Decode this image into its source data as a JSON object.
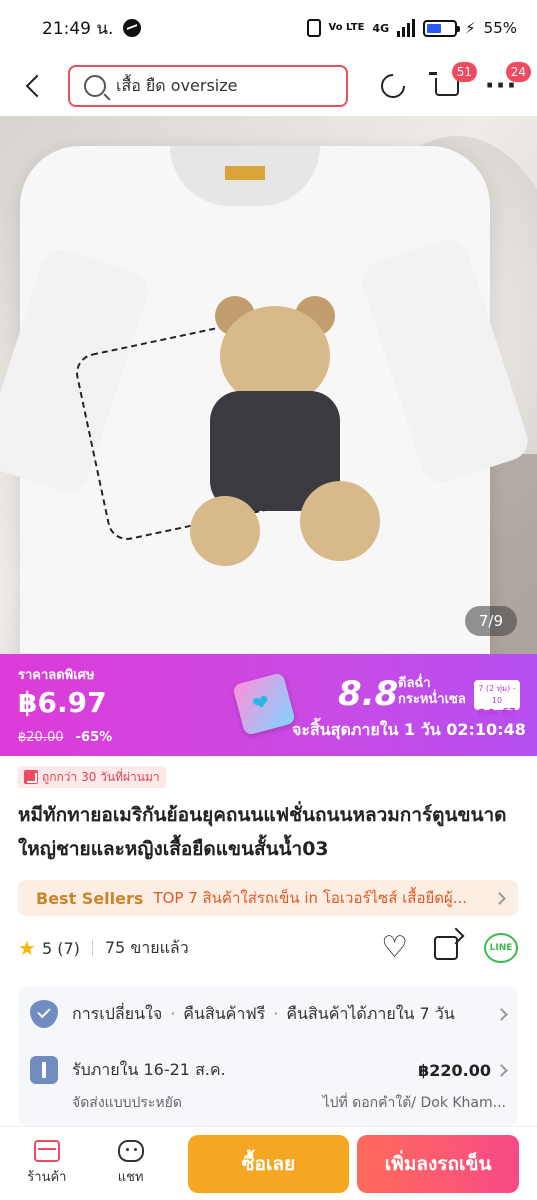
{
  "status_bar": {
    "time": "21:49 น.",
    "battery": "55%",
    "battery_level": 0.55,
    "network": "4G",
    "volte": "Vo LTE"
  },
  "nav": {
    "search_text": "เสื้อ ยืด oversize",
    "cart_badge": "51",
    "more_badge": "24"
  },
  "product_image": {
    "counter": "7/9"
  },
  "promo": {
    "label": "ราคาลดพิเศษ",
    "price": "฿6.97",
    "original_price": "฿20.00",
    "discount": "-65%",
    "event_big": "8.8",
    "event_line1": "ดีลฉ่ำ",
    "event_line2": "กระหน่ำเซล",
    "event_date_top": "7 (2 ทุ่ม) - 10",
    "event_date_bottom": "ส.ค. 67",
    "countdown": "จะสิ้นสุดภายใน 1 วัน 02:10:48"
  },
  "low_price_tag": "ถูกกว่า 30 วันที่ผ่านมา",
  "product": {
    "title": "หมีทักทายอเมริกันย้อนยุคถนนแฟชั่นถนนหลวมการ์ตูนขนาดใหญ่ชายและหญิงเสื้อยืดแขนสั้นน้ำ03"
  },
  "best_sellers": {
    "logo": "Best Sellers",
    "text": "TOP 7 สินค้าใส่รถเข็น in โอเวอร์ไซส์ เสื้อยืดผู้..."
  },
  "rating": {
    "score": "5 (7)",
    "sold": "75 ขายแล้ว"
  },
  "info": {
    "policy_1": "การเปลี่ยนใจ",
    "policy_2": "คืนสินค้าฟรี",
    "policy_3": "คืนสินค้าได้ภายใน 7 วัน",
    "delivery": "รับภายใน 16-21 ส.ค.",
    "shipping_price": "฿220.00",
    "shipping_type": "จัดส่งแบบประหยัด",
    "destination": "ไปที่ ดอกคำใต้/ Dok Kham..."
  },
  "bottom_bar": {
    "store_label": "ร้านค้า",
    "chat_label": "แชท",
    "buy_label": "ซื้อเลย",
    "add_cart_label": "เพิ่มลงรถเข็น"
  },
  "colors": {
    "accent": "#ef4a5f",
    "promo_bg": "#d03ee0",
    "buy_button": "#f5a623",
    "cart_button": "#f74a86"
  }
}
